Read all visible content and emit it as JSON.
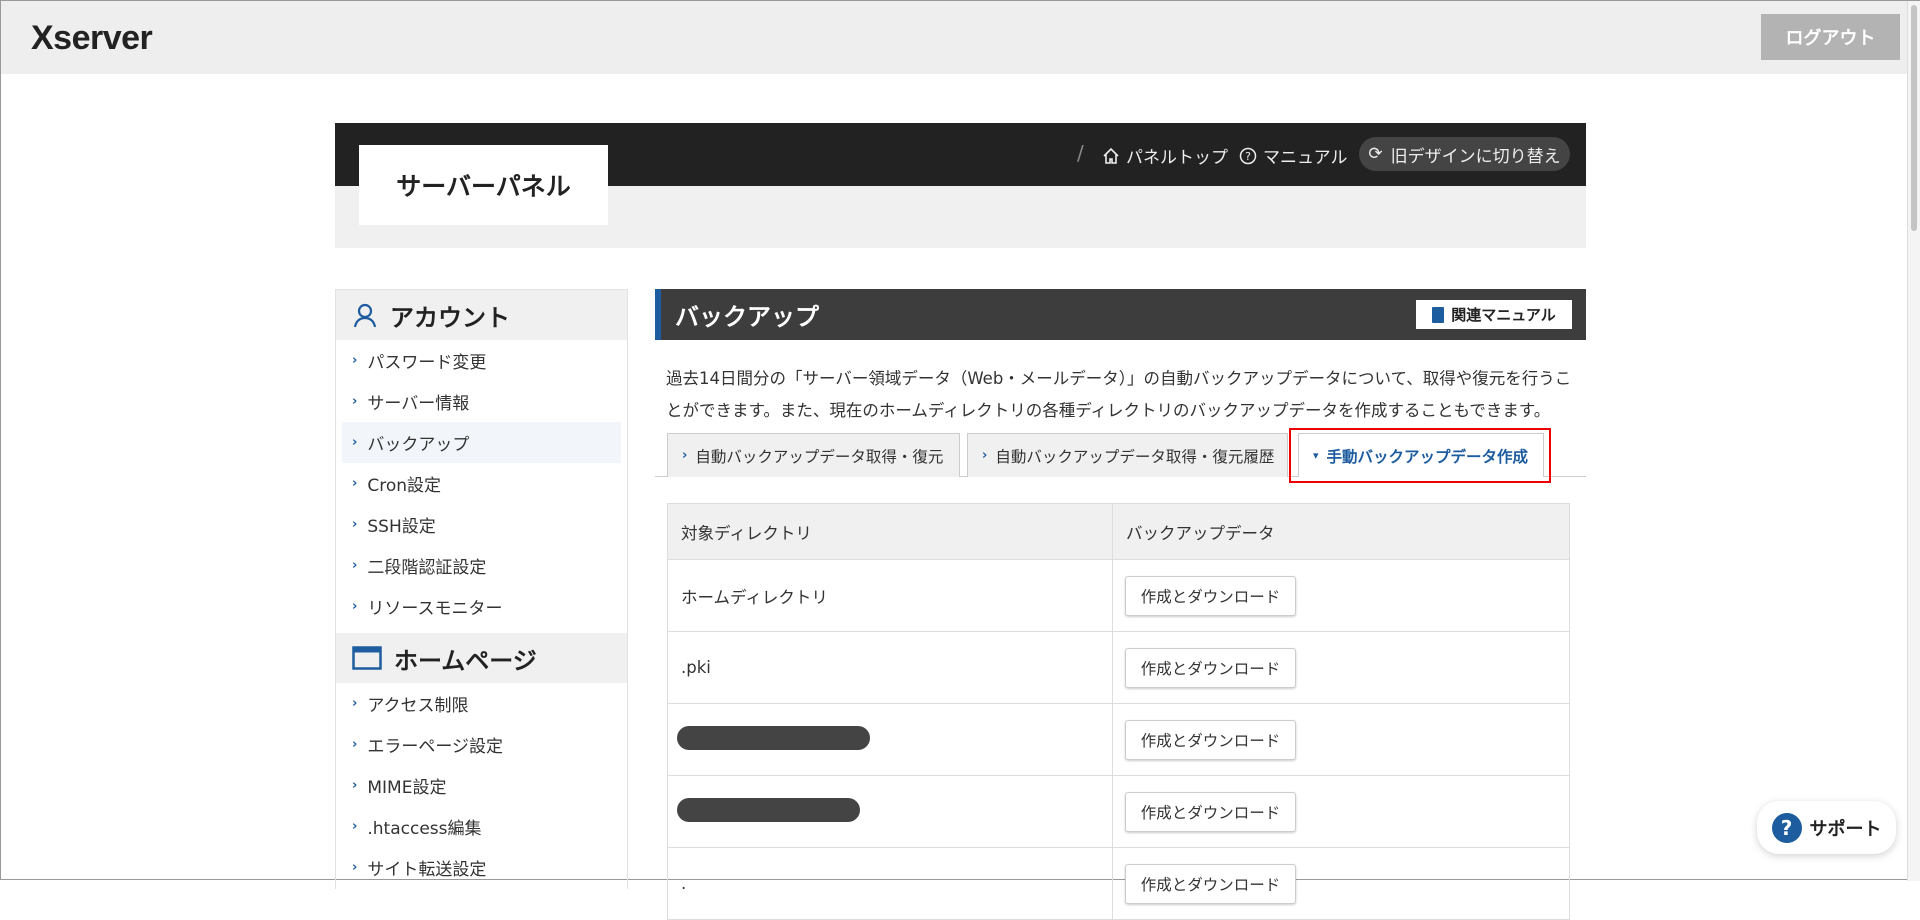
{
  "header": {
    "logo": "Xserver",
    "logout": "ログアウト"
  },
  "panel": {
    "title": "サーバーパネル",
    "nav": {
      "separator": "/",
      "top": "パネルトップ",
      "manual": "マニュアル",
      "switch": "旧デザインに切り替え"
    }
  },
  "sidebar": {
    "sections": [
      {
        "title": "アカウント",
        "icon": "user-icon",
        "items": [
          "パスワード変更",
          "サーバー情報",
          "バックアップ",
          "Cron設定",
          "SSH設定",
          "二段階認証設定",
          "リソースモニター"
        ]
      },
      {
        "title": "ホームページ",
        "icon": "browser-window-icon",
        "items": [
          "アクセス制限",
          "エラーページ設定",
          "MIME設定",
          ".htaccess編集",
          "サイト転送設定"
        ]
      }
    ],
    "active": "バックアップ"
  },
  "main": {
    "title": "バックアップ",
    "manual_button": "関連マニュアル",
    "description": "過去14日間分の「サーバー領域データ（Web・メールデータ）」の自動バックアップデータについて、取得や復元を行うことができます。また、現在のホームディレクトリの各種ディレクトリのバックアップデータを作成することもできます。",
    "tabs": [
      "自動バックアップデータ取得・復元",
      "自動バックアップデータ取得・復元履歴",
      "手動バックアップデータ作成"
    ],
    "selected_tab": "手動バックアップデータ作成",
    "table": {
      "headers": [
        "対象ディレクトリ",
        "バックアップデータ"
      ],
      "rows": [
        {
          "dir": "ホームディレクトリ",
          "button": "作成とダウンロード"
        },
        {
          "dir": ".pki",
          "button": "作成とダウンロード"
        },
        {
          "dir": "",
          "redacted": true,
          "button": "作成とダウンロード"
        },
        {
          "dir": "",
          "redacted": true,
          "button": "作成とダウンロード"
        },
        {
          "dir": ".",
          "button": "作成とダウンロード"
        }
      ]
    }
  },
  "support": "サポート",
  "colors": {
    "accent": "#1d5c9e",
    "highlight": "#ee0000",
    "dark": "#222222"
  }
}
